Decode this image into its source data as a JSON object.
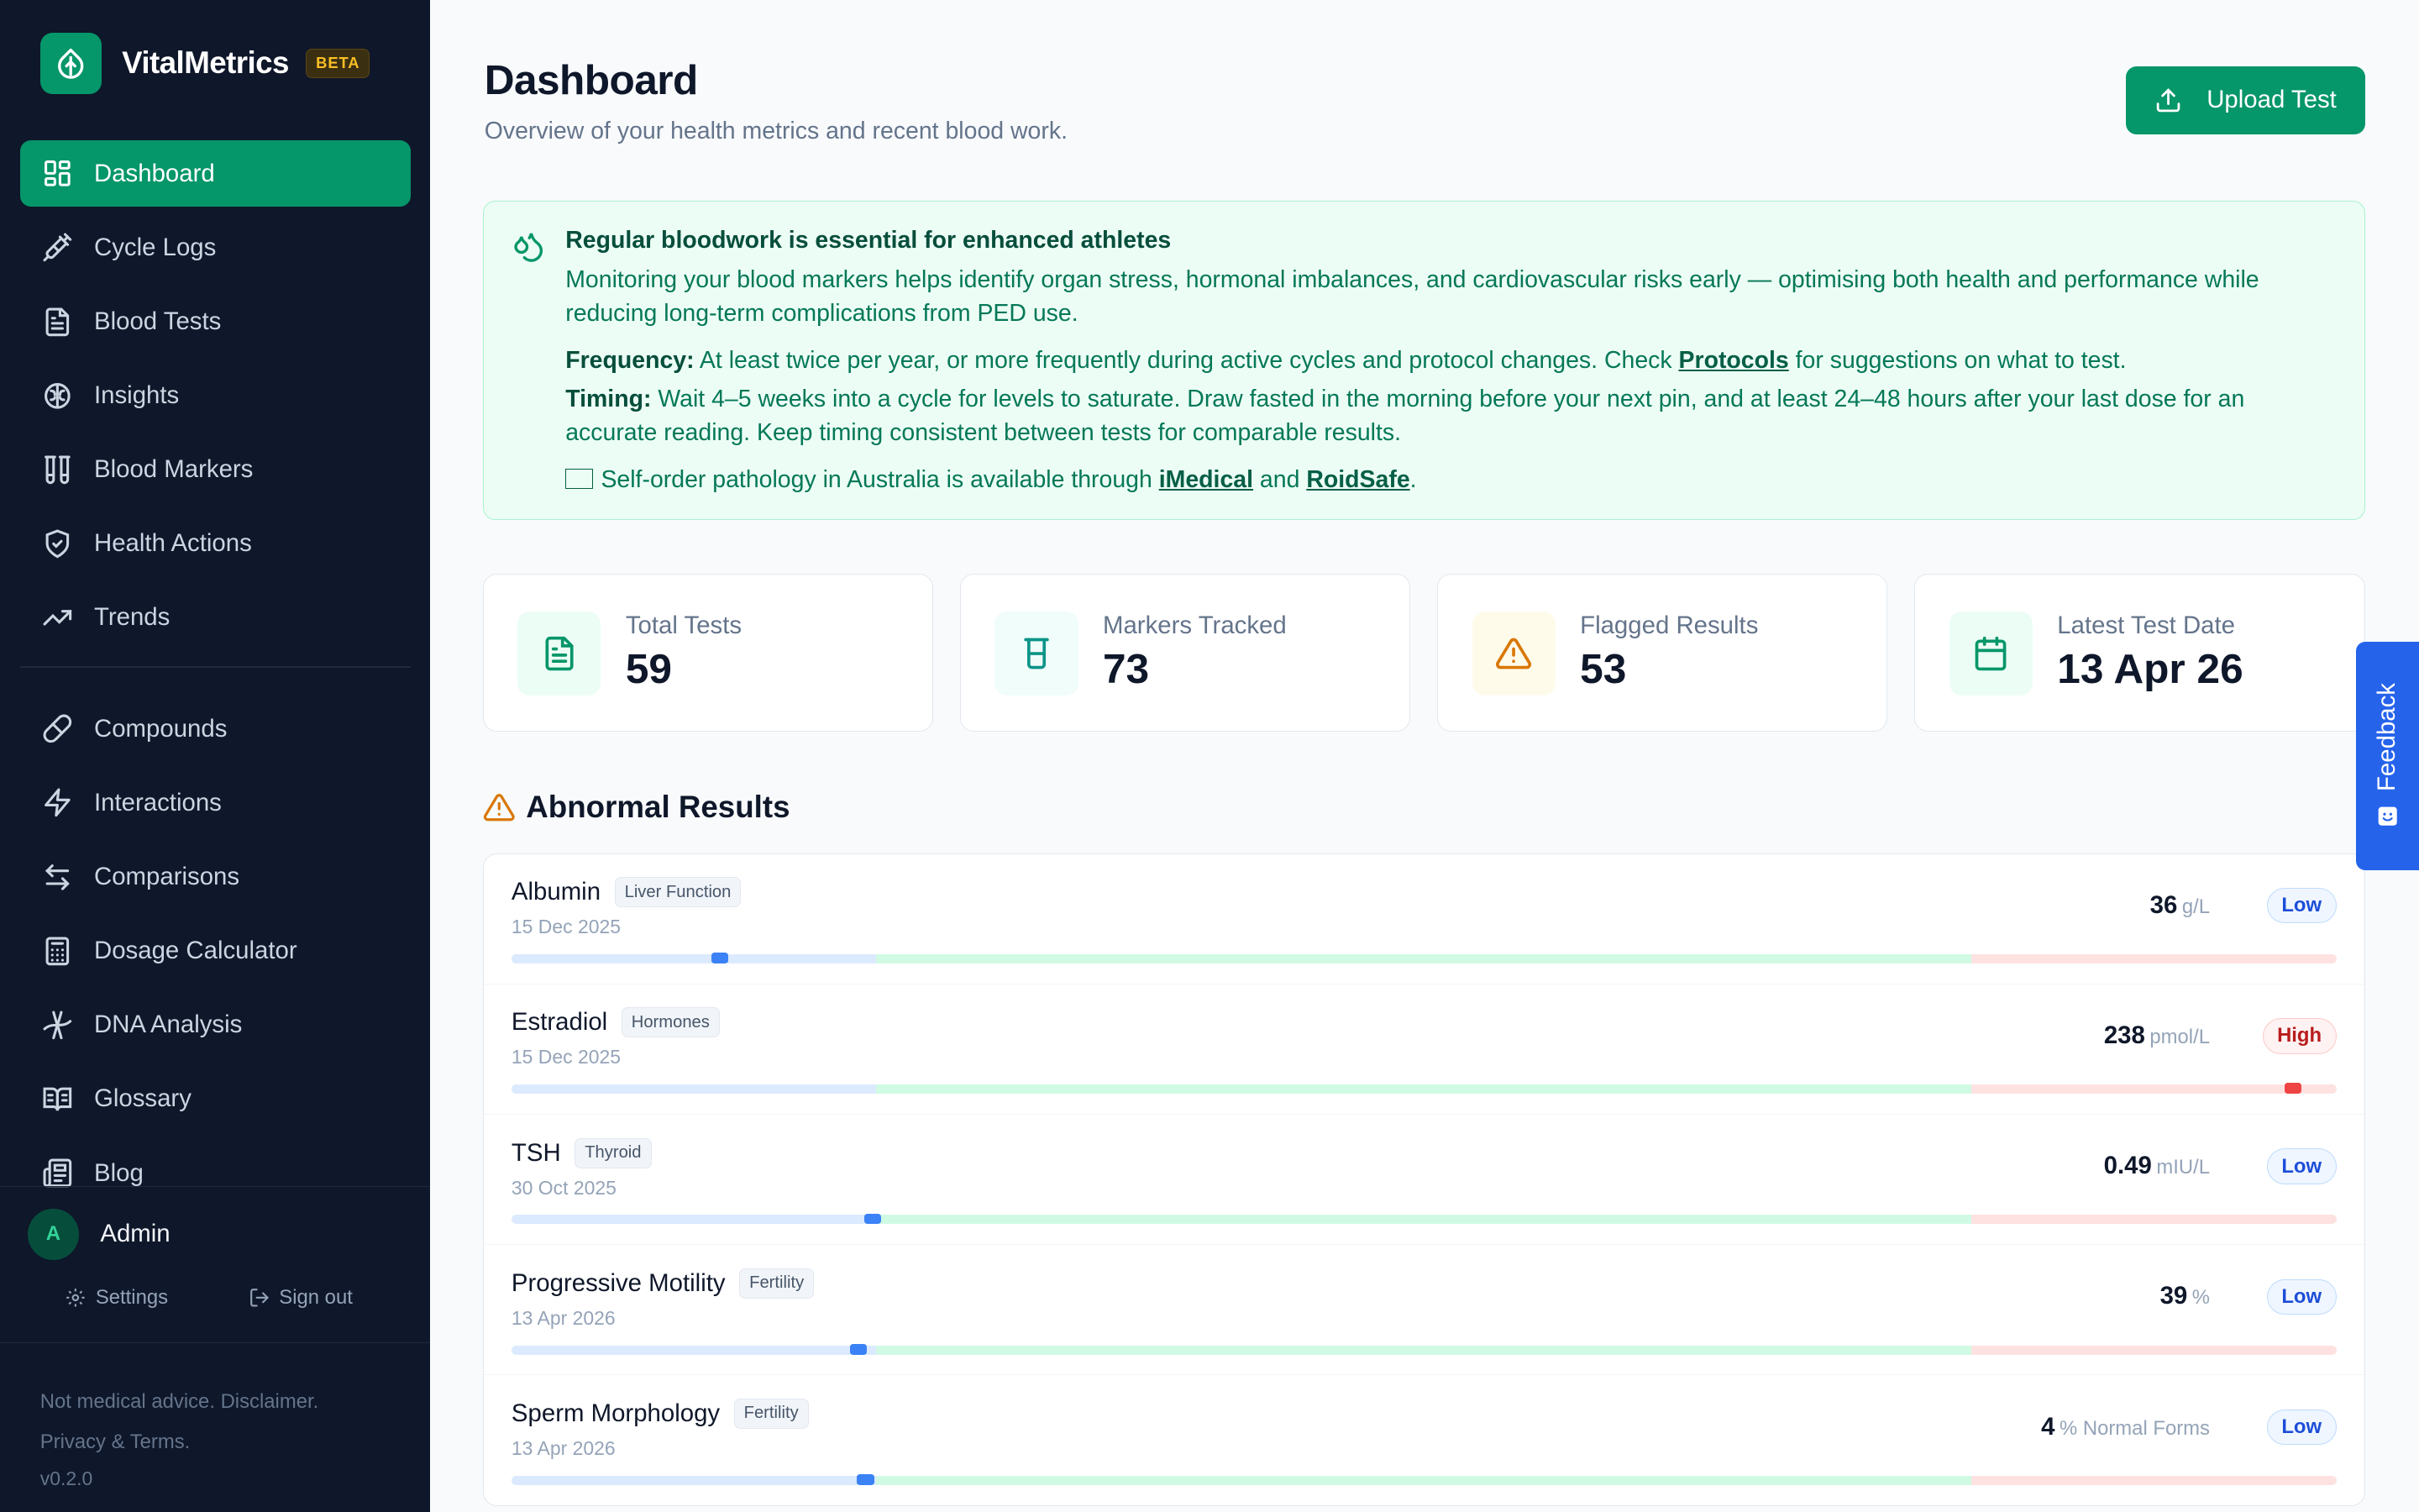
{
  "brand": {
    "name": "VitalMetrics",
    "badge": "BETA"
  },
  "nav": {
    "primary": [
      {
        "label": "Dashboard",
        "icon": "dashboard-icon",
        "active": true
      },
      {
        "label": "Cycle Logs",
        "icon": "syringe-icon"
      },
      {
        "label": "Blood Tests",
        "icon": "document-icon"
      },
      {
        "label": "Insights",
        "icon": "brain-icon"
      },
      {
        "label": "Blood Markers",
        "icon": "test-tubes-icon"
      },
      {
        "label": "Health Actions",
        "icon": "shield-check-icon"
      },
      {
        "label": "Trends",
        "icon": "trending-up-icon"
      }
    ],
    "secondary": [
      {
        "label": "Compounds",
        "icon": "pill-icon"
      },
      {
        "label": "Interactions",
        "icon": "zap-icon"
      },
      {
        "label": "Comparisons",
        "icon": "arrows-icon"
      },
      {
        "label": "Dosage Calculator",
        "icon": "calculator-icon"
      },
      {
        "label": "DNA Analysis",
        "icon": "dna-icon"
      },
      {
        "label": "Glossary",
        "icon": "book-icon"
      },
      {
        "label": "Blog",
        "icon": "newspaper-icon"
      }
    ]
  },
  "user": {
    "initial": "A",
    "name": "Admin",
    "settings_label": "Settings",
    "signout_label": "Sign out"
  },
  "footer": {
    "disclaimer": "Not medical advice. Disclaimer.",
    "privacy": "Privacy & Terms.",
    "version": "v0.2.0"
  },
  "header": {
    "title": "Dashboard",
    "subtitle": "Overview of your health metrics and recent blood work.",
    "upload_label": "Upload Test"
  },
  "info": {
    "title": "Regular bloodwork is essential for enhanced athletes",
    "body": "Monitoring your blood markers helps identify organ stress, hormonal imbalances, and cardiovascular risks early — optimising both health and performance while reducing long-term complications from PED use.",
    "frequency_label": "Frequency:",
    "frequency_text": " At least twice per year, or more frequently during active cycles and protocol changes. Check ",
    "protocols_link": "Protocols",
    "frequency_tail": " for suggestions on what to test.",
    "timing_label": "Timing:",
    "timing_text": " Wait 4–5 weeks into a cycle for levels to saturate. Draw fasted in the morning before your next pin, and at least 24–48 hours after your last dose for an accurate reading. Keep timing consistent between tests for comparable results.",
    "au_text": "Self-order pathology in Australia is available through ",
    "imedical_link": "iMedical",
    "and_text": " and ",
    "roidsafe_link": "RoidSafe",
    "period": "."
  },
  "stats": [
    {
      "label": "Total Tests",
      "value": "59",
      "icon": "document-icon",
      "color": "#059669",
      "bg": "#ecfdf5"
    },
    {
      "label": "Markers Tracked",
      "value": "73",
      "icon": "beaker-icon",
      "color": "#0d9488",
      "bg": "#f0fdfa"
    },
    {
      "label": "Flagged Results",
      "value": "53",
      "icon": "warning-icon",
      "color": "#d97706",
      "bg": "#fffbeb"
    },
    {
      "label": "Latest Test Date",
      "value": "13 Apr 26",
      "icon": "calendar-icon",
      "color": "#059669",
      "bg": "#ecfdf5"
    }
  ],
  "abnormal": {
    "title": "Abnormal Results",
    "rows": [
      {
        "name": "Albumin",
        "category": "Liver Function",
        "date": "15 Dec 2025",
        "value": "36",
        "unit": "g/L",
        "status": "Low",
        "position": 0.114
      },
      {
        "name": "Estradiol",
        "category": "Hormones",
        "date": "15 Dec 2025",
        "value": "238",
        "unit": "pmol/L",
        "status": "High",
        "position": 0.976
      },
      {
        "name": "TSH",
        "category": "Thyroid",
        "date": "30 Oct 2025",
        "value": "0.49",
        "unit": "mIU/L",
        "status": "Low",
        "position": 0.198
      },
      {
        "name": "Progressive Motility",
        "category": "Fertility",
        "date": "13 Apr 2026",
        "value": "39",
        "unit": "%",
        "status": "Low",
        "position": 0.19
      },
      {
        "name": "Sperm Morphology",
        "category": "Fertility",
        "date": "13 Apr 2026",
        "value": "4",
        "unit": "% Normal Forms",
        "status": "Low",
        "position": 0.194
      }
    ]
  },
  "feedback": {
    "label": "Feedback"
  }
}
